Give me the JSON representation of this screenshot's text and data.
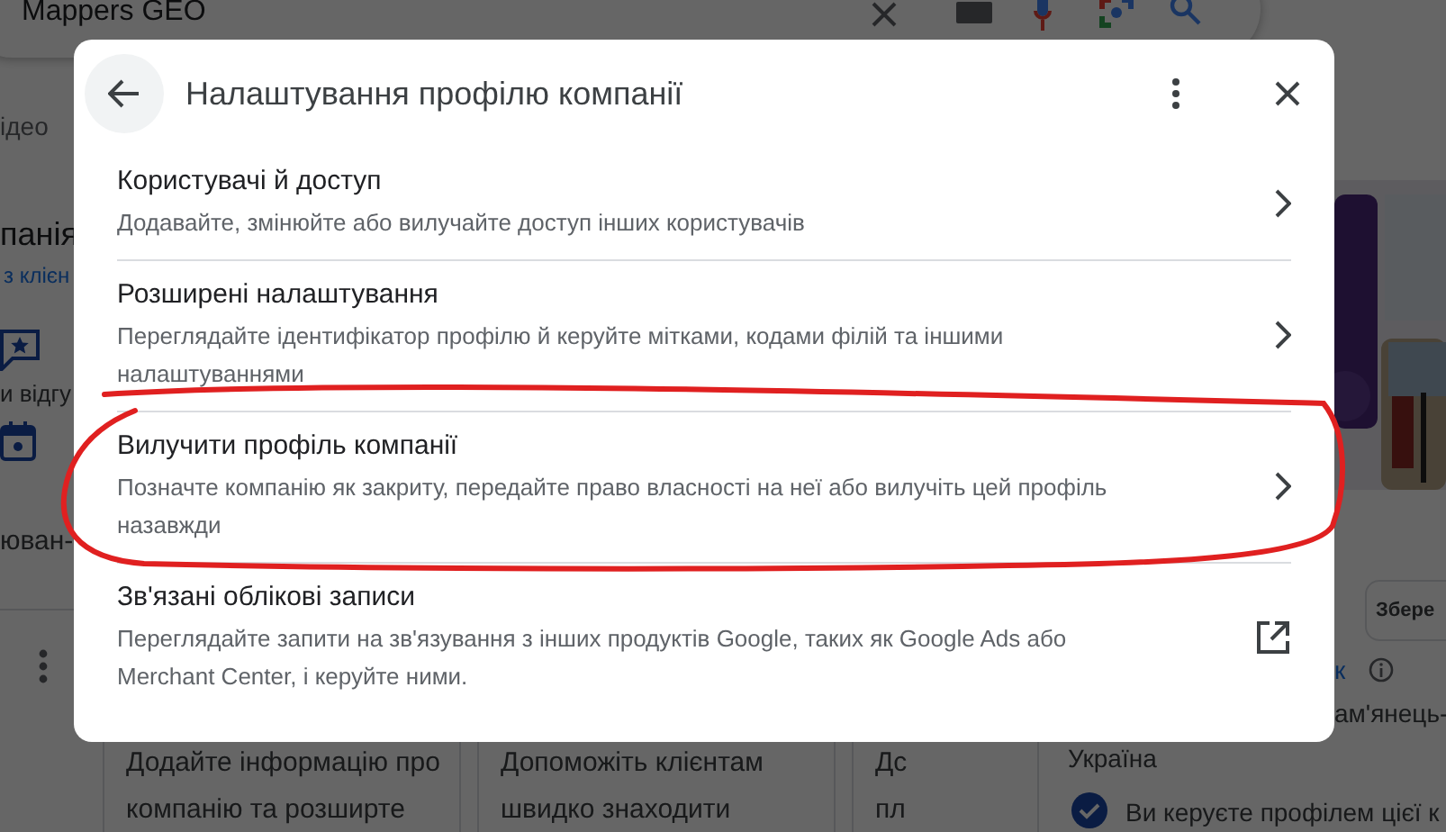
{
  "search": {
    "value": "Mappers GEO"
  },
  "page": {
    "tab_fragment": "ідео",
    "title_fragment": "панія",
    "link_fragment": "з клієн",
    "actions": [
      {
        "kind": "reviews",
        "label": "и відгу"
      },
      {
        "kind": "booking",
        "label": "юван-"
      }
    ],
    "save_button": "Збере",
    "side_link": "к",
    "city": "ам'янець-",
    "country": "Україна",
    "managed_note": "Ви керуєте профілем цієї к",
    "cards": [
      {
        "lines": [
          "Додайте інформацію про",
          "компанію та розширте"
        ]
      },
      {
        "lines": [
          "Допоможіть клієнтам",
          "швидко знаходити"
        ]
      },
      {
        "lines": [
          "Дс",
          "пл"
        ]
      }
    ]
  },
  "dialog": {
    "title": "Налаштування профілю компанії",
    "items": [
      {
        "kind": "link",
        "title": "Користувачі й доступ",
        "description": "Додавайте, змінюйте або вилучайте доступ інших користувачів"
      },
      {
        "kind": "link",
        "title": "Розширені налаштування",
        "description": "Переглядайте ідентифікатор профілю й керуйте мітками, кодами філій та іншими налаштуваннями"
      },
      {
        "kind": "link",
        "title": "Вилучити профіль компанії",
        "description": "Позначте компанію як закриту, передайте право власності на неї або вилучіть цей профіль назавжди"
      },
      {
        "kind": "external",
        "title": "Зв'язані облікові записи",
        "description": "Переглядайте запити на зв'язування з інших продуктів Google, таких як Google Ads або Merchant Center, і керуйте ними."
      }
    ]
  }
}
